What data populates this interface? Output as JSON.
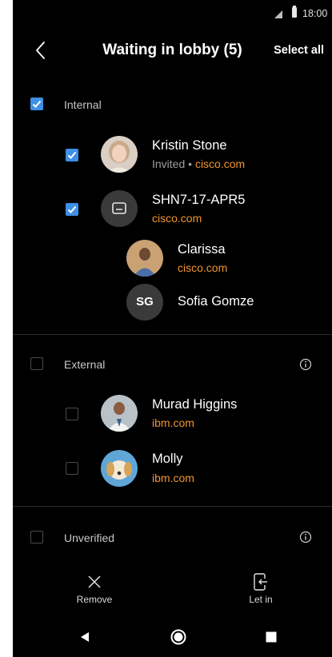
{
  "status_bar": {
    "time": "18:00"
  },
  "header": {
    "title": "Waiting in lobby (5)",
    "select_all": "Select all"
  },
  "sections": {
    "internal": {
      "label": "Internal",
      "checked": true,
      "people": [
        {
          "name": "Kristin Stone",
          "status": "Invited",
          "separator": "•",
          "domain": "cisco.com",
          "checked": true
        },
        {
          "name": "SHN7-17-APR5",
          "domain": "cisco.com",
          "checked": true
        },
        {
          "name": "Clarissa",
          "domain": "cisco.com"
        },
        {
          "name": "Sofia Gomze",
          "initials": "SG"
        }
      ]
    },
    "external": {
      "label": "External",
      "checked": false,
      "people": [
        {
          "name": "Murad Higgins",
          "domain": "ibm.com",
          "checked": false
        },
        {
          "name": "Molly",
          "domain": "ibm.com",
          "checked": false
        }
      ]
    },
    "unverified": {
      "label": "Unverified",
      "checked": false
    }
  },
  "actions": {
    "remove": "Remove",
    "let_in": "Let in"
  },
  "colors": {
    "background": "#000000",
    "accent_blue": "#3f8fe6",
    "domain_orange": "#f0952e",
    "divider": "#2b2b2b"
  }
}
